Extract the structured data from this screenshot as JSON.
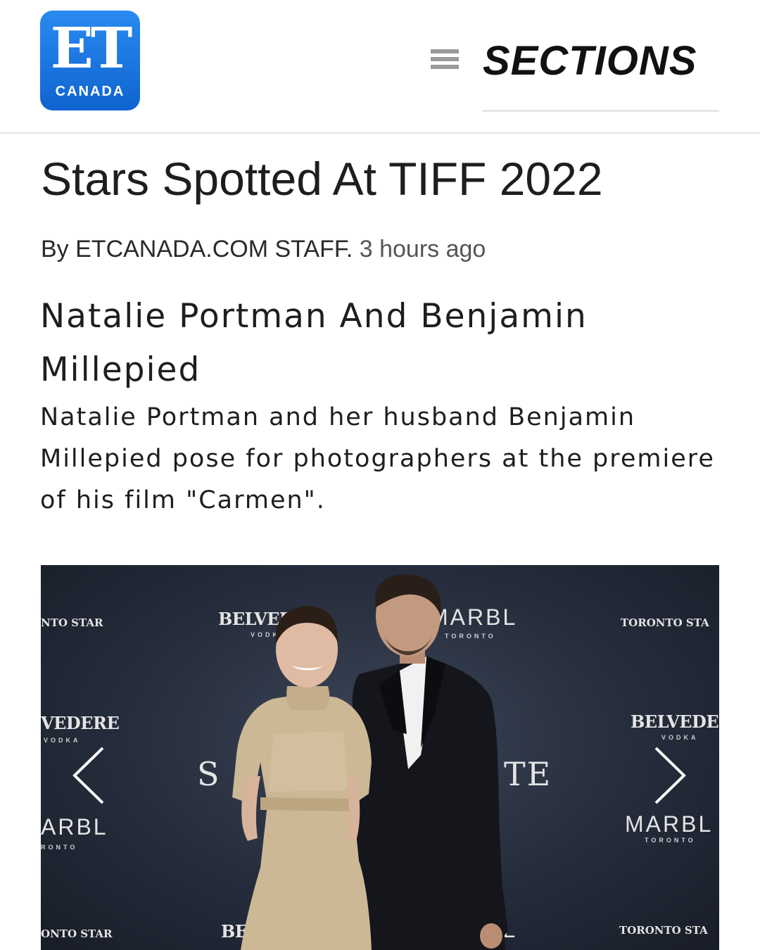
{
  "header": {
    "logo": {
      "text": "ET",
      "subtext": "CANADA"
    },
    "menu_icon": "hamburger-menu-icon",
    "sections_label": "SECTIONS",
    "brand_color": "#1574e0"
  },
  "article": {
    "title": "Stars Spotted At TIFF 2022",
    "byline": "By ETCANADA.COM STAFF.",
    "timestamp": "3 hours ago"
  },
  "gallery": {
    "slide_title": "Natalie Portman And Benjamin Millepied",
    "caption": "Natalie Portman and her husband Benjamin Millepied pose for photographers at the premiere of his film \"Carmen\".",
    "prev_icon": "chevron-left-icon",
    "next_icon": "chevron-right-icon",
    "backdrop_text": {
      "toronto_star_left": "NTO STAR",
      "toronto_star_right": "TORONTO STA",
      "belvedere_top": "BELVEDE",
      "vodka_top": "VODK",
      "marbl_top": "MARBL",
      "toronto_top": "TORONTO",
      "belvedere_left": "VEDERE",
      "vodka_left": "VODKA",
      "belvedere_right": "BELVEDER",
      "vodka_right": "VODKA",
      "logo_left": "S",
      "logo_right": "TE",
      "marbl_left": "ARBL",
      "toronto_left": "RONTO",
      "marbl_right": "MARBL",
      "toronto_right": "TORONTO",
      "toronto_star_bottom_left": "ONTO STAR",
      "belvedere_bottom": "BE",
      "marbl_bottom": "BL",
      "toronto_star_bottom_right": "TORONTO STA"
    }
  }
}
